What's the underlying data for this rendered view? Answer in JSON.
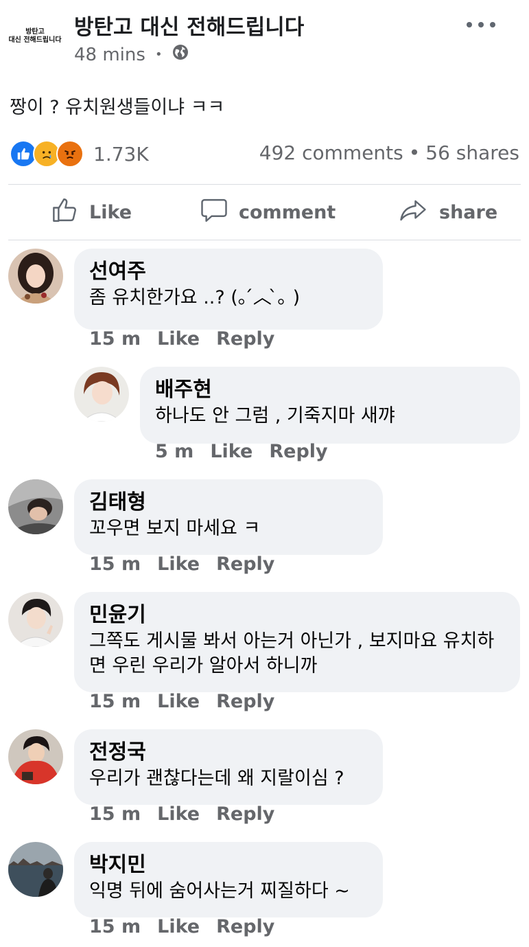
{
  "post": {
    "page_avatar_line1": "방탄고",
    "page_avatar_line2": "대신 전해드립니다",
    "page_name": "방탄고 대신 전해드립니다",
    "time": "48 mins",
    "separator": "•",
    "privacy_icon": "globe-icon",
    "text": "짱이 ? 유치원생들이냐 ㅋㅋ",
    "reaction_icons": [
      "like-icon",
      "sad-icon",
      "angry-icon"
    ],
    "reaction_count": "1.73K",
    "comments_count": "492 comments",
    "stats_separator": "•",
    "shares_count": "56 shares"
  },
  "actions": {
    "like_label": "Like",
    "comment_label": "comment",
    "share_label": "share"
  },
  "comments": [
    {
      "name": "선여주",
      "text": "좀 유치한가요 ..? (｡ ́︿ ̀｡ )",
      "time": "15 m",
      "like": "Like",
      "reply": "Reply"
    },
    {
      "name": "배주현",
      "text": "하나도 안 그럼 , 기죽지마 새꺄",
      "time": "5 m",
      "like": "Like",
      "reply": "Reply"
    },
    {
      "name": "김태형",
      "text": "꼬우면 보지 마세요 ㅋ",
      "time": "15 m",
      "like": "Like",
      "reply": "Reply"
    },
    {
      "name": "민윤기",
      "text": "그쪽도 게시물 봐서 아는거 아닌가 , 보지마요 유치하면 우린 우리가 알아서 하니까",
      "time": "15 m",
      "like": "Like",
      "reply": "Reply"
    },
    {
      "name": "전정국",
      "text": "우리가 괜찮다는데 왜 지랄이심 ?",
      "time": "15 m",
      "like": "Like",
      "reply": "Reply"
    },
    {
      "name": "박지민",
      "text": "익명 뒤에 숨어사는거 찌질하다 ~",
      "time": "15 m",
      "like": "Like",
      "reply": "Reply"
    }
  ],
  "colors": {
    "accent": "#1877f2",
    "meta_gray": "#65676b",
    "bubble_bg": "#f0f2f5"
  }
}
